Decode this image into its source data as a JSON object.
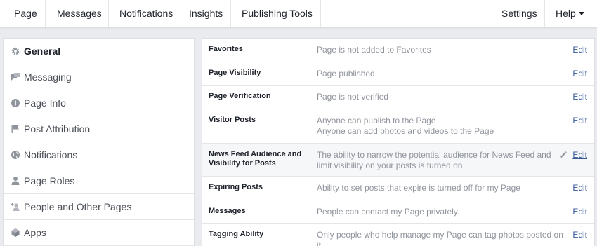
{
  "topnav": {
    "left": [
      "Page",
      "Messages",
      "Notifications",
      "Insights",
      "Publishing Tools"
    ],
    "settings": "Settings",
    "help": "Help"
  },
  "sidebar": {
    "items": [
      {
        "label": "General",
        "icon": "gear-icon",
        "active": true
      },
      {
        "label": "Messaging",
        "icon": "chat-bubbles-icon"
      },
      {
        "label": "Page Info",
        "icon": "info-icon"
      },
      {
        "label": "Post Attribution",
        "icon": "flag-icon"
      },
      {
        "label": "Notifications",
        "icon": "globe-icon"
      },
      {
        "label": "Page Roles",
        "icon": "person-icon"
      },
      {
        "label": "People and Other Pages",
        "icon": "add-person-icon"
      },
      {
        "label": "Apps",
        "icon": "cube-icon"
      }
    ]
  },
  "settings": {
    "edit_label": "Edit",
    "rows": [
      {
        "label": "Favorites",
        "value": [
          "Page is not added to Favorites"
        ]
      },
      {
        "label": "Page Visibility",
        "value": [
          "Page published"
        ]
      },
      {
        "label": "Page Verification",
        "value": [
          "Page is not verified"
        ]
      },
      {
        "label": "Visitor Posts",
        "value": [
          "Anyone can publish to the Page",
          "Anyone can add photos and videos to the Page"
        ]
      },
      {
        "label": "News Feed Audience and Visibility for Posts",
        "value": [
          "The ability to narrow the potential audience for News Feed and limit visibility on your posts is turned on"
        ],
        "highlighted": true
      },
      {
        "label": "Expiring Posts",
        "value": [
          "Ability to set posts that expire is turned off for my Page"
        ]
      },
      {
        "label": "Messages",
        "value": [
          "People can contact my Page privately."
        ]
      },
      {
        "label": "Tagging Ability",
        "value": [
          "Only people who help manage my Page can tag photos posted on it."
        ]
      }
    ]
  },
  "colors": {
    "link": "#365899",
    "muted": "#90949c",
    "icon": "#90949c",
    "background": "#e9ebee"
  }
}
